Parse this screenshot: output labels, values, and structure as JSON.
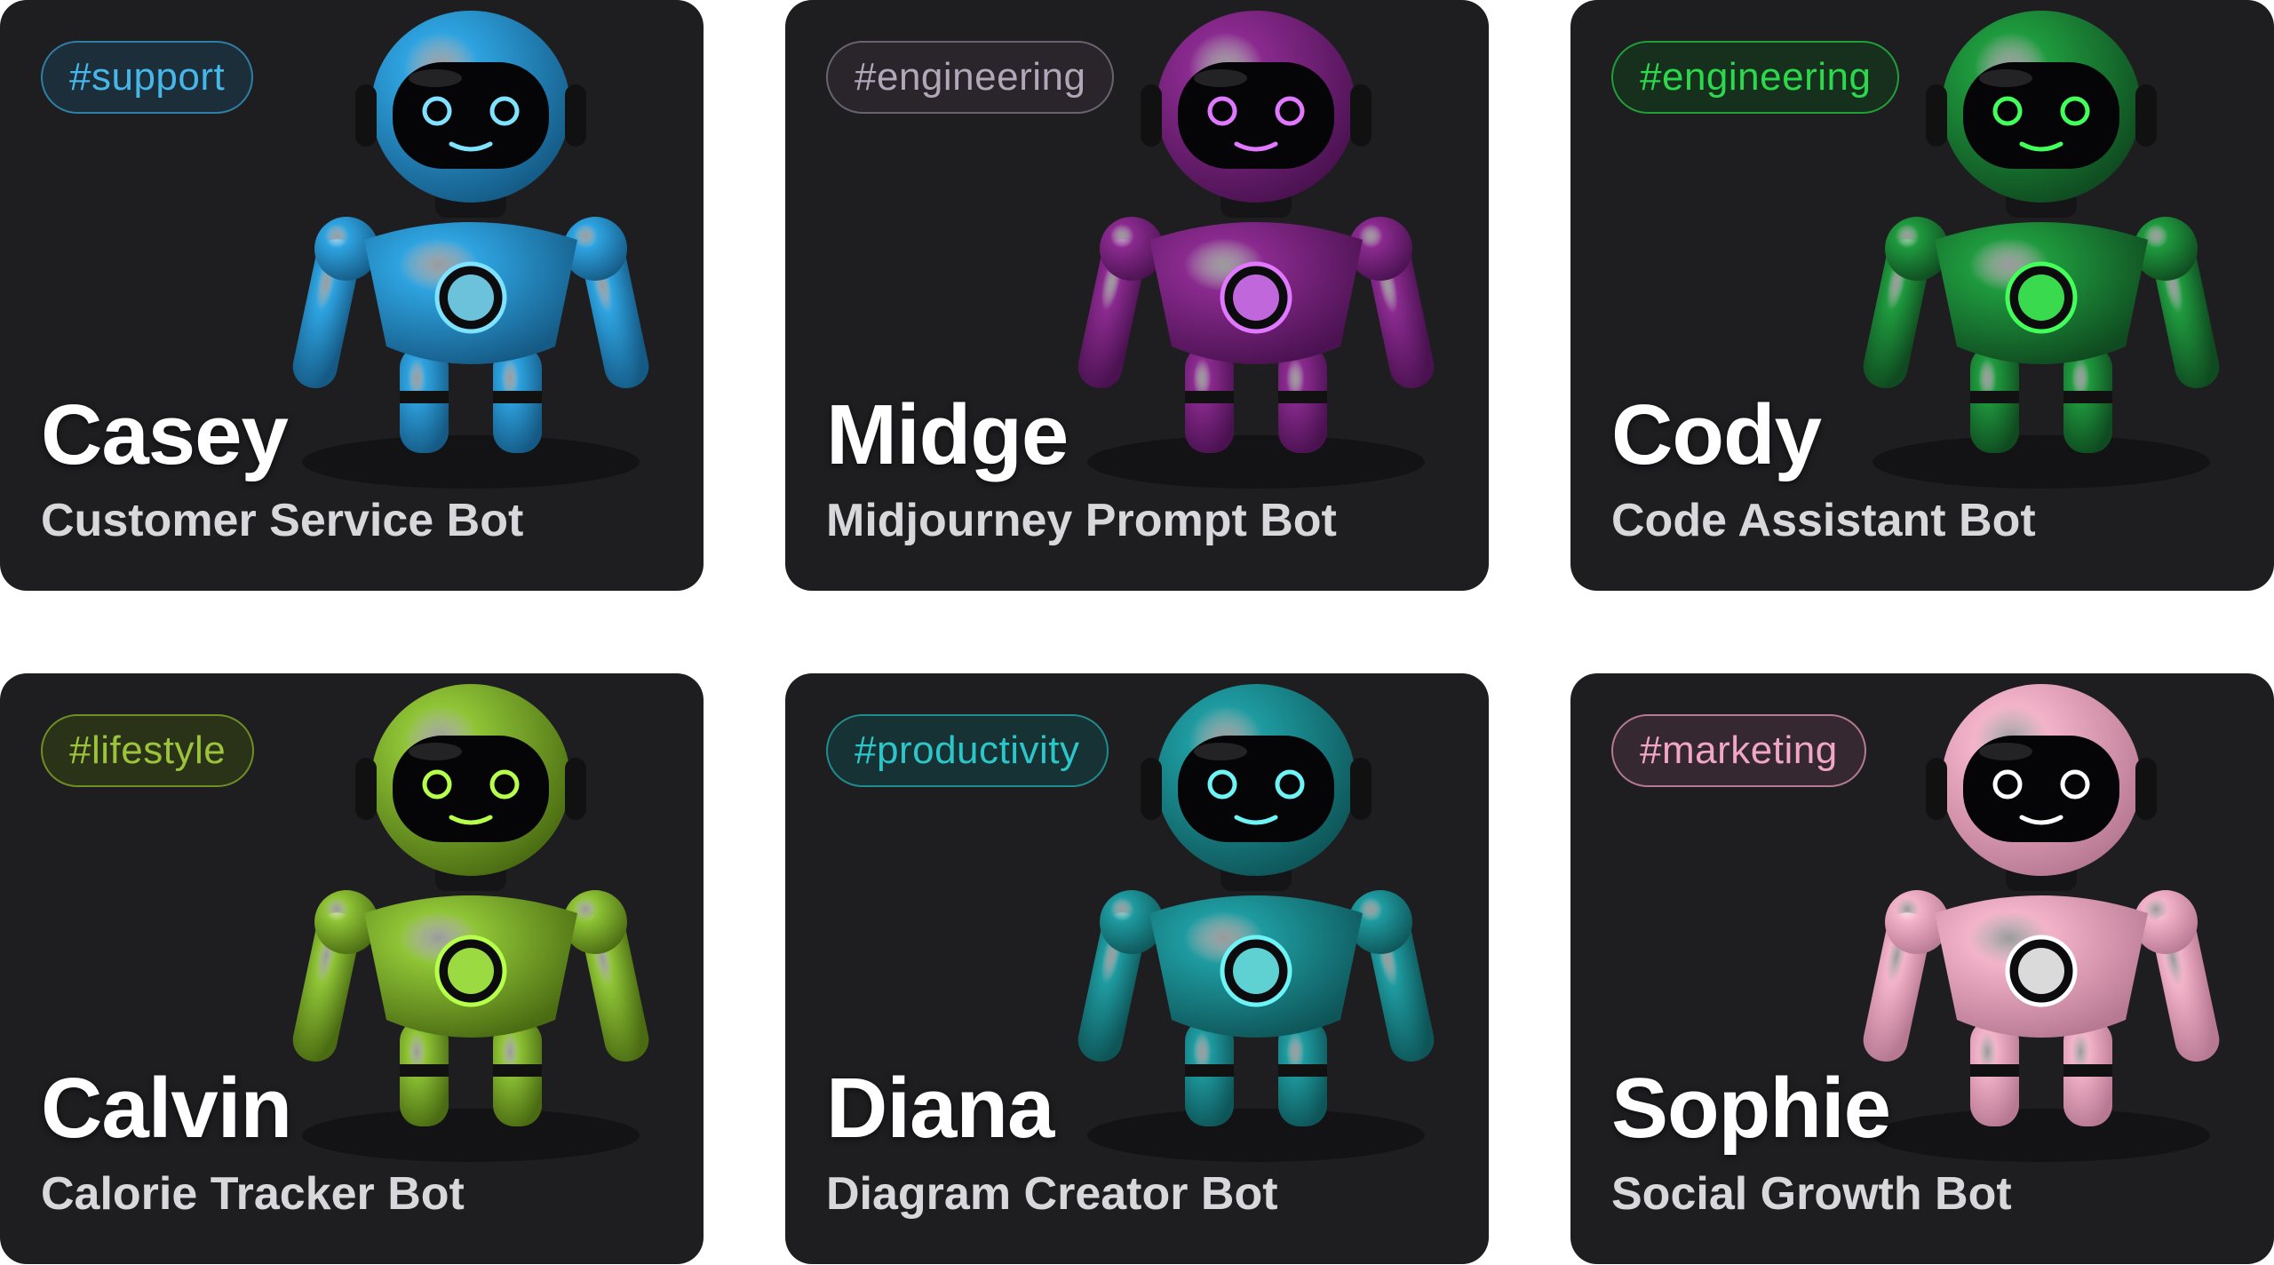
{
  "cards": [
    {
      "tag": "#support",
      "name": "Casey",
      "role": "Customer Service Bot",
      "tag_color": "#46b7e8",
      "tag_border": "#2e7fa6",
      "tag_bg": "#1b2e3a",
      "robot_color": "#2ea3e0",
      "robot_dark": "#155a85",
      "accent": "#7fe3ff"
    },
    {
      "tag": "#engineering",
      "name": "Midge",
      "role": "Midjourney Prompt Bot",
      "tag_color": "#b0a8b8",
      "tag_border": "#6b6270",
      "tag_bg": "#29252b",
      "robot_color": "#8a2a8f",
      "robot_dark": "#4a1250",
      "accent": "#e079ff"
    },
    {
      "tag": "#engineering",
      "name": "Cody",
      "role": "Code Assistant Bot",
      "tag_color": "#2bd94c",
      "tag_border": "#1f9f38",
      "tag_bg": "#16301d",
      "robot_color": "#1f9a3e",
      "robot_dark": "#0f4a20",
      "accent": "#43ff5a"
    },
    {
      "tag": "#lifestyle",
      "name": "Calvin",
      "role": "Calorie Tracker Bot",
      "tag_color": "#9cc43a",
      "tag_border": "#6f8f25",
      "tag_bg": "#2a3218",
      "robot_color": "#8fc436",
      "robot_dark": "#4a6b12",
      "accent": "#b6ff4a"
    },
    {
      "tag": "#productivity",
      "name": "Diana",
      "role": "Diagram Creator Bot",
      "tag_color": "#2cc6c9",
      "tag_border": "#1f8c8f",
      "tag_bg": "#173234",
      "robot_color": "#1e9ba0",
      "robot_dark": "#0e5558",
      "accent": "#6ff4f6"
    },
    {
      "tag": "#marketing",
      "name": "Sophie",
      "role": "Social Growth Bot",
      "tag_color": "#f0a6c4",
      "tag_border": "#b57a92",
      "tag_bg": "#352830",
      "robot_color": "#f3b3c9",
      "robot_dark": "#b77892",
      "accent": "#ffffff"
    }
  ]
}
